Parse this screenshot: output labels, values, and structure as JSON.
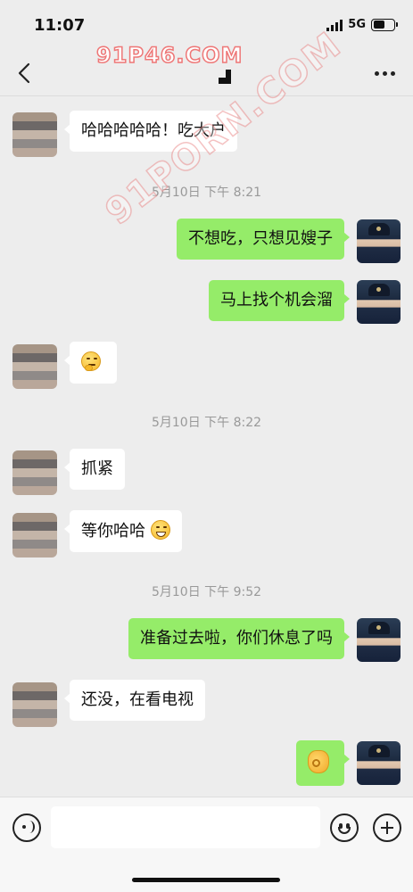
{
  "status_bar": {
    "time": "11:07",
    "network": "5G"
  },
  "header": {
    "watermark": "91P46.COM",
    "diagonal_watermark": "91PORN.COM"
  },
  "messages": [
    {
      "side": "left",
      "text": "哈哈哈哈哈！吃大户"
    },
    {
      "type": "timestamp",
      "text": "5月10日 下午 8:21"
    },
    {
      "side": "right",
      "text": "不想吃，只想见嫂子"
    },
    {
      "side": "right",
      "text": "马上找个机会溜"
    },
    {
      "side": "left",
      "emoji": "thinking-face"
    },
    {
      "type": "timestamp",
      "text": "5月10日 下午 8:22"
    },
    {
      "side": "left",
      "text": "抓紧"
    },
    {
      "side": "left",
      "text": "等你哈哈",
      "emoji": "grinning-face"
    },
    {
      "type": "timestamp",
      "text": "5月10日 下午 9:52"
    },
    {
      "side": "right",
      "text": "准备过去啦，你们休息了吗"
    },
    {
      "side": "left",
      "text": "还没，在看电视"
    },
    {
      "side": "right",
      "emoji": "ok-hand"
    }
  ],
  "colors": {
    "background": "#ededed",
    "bubble_right": "#95ec69",
    "bubble_left": "#ffffff",
    "timestamp": "#999999"
  },
  "input_bar": {
    "placeholder": ""
  }
}
